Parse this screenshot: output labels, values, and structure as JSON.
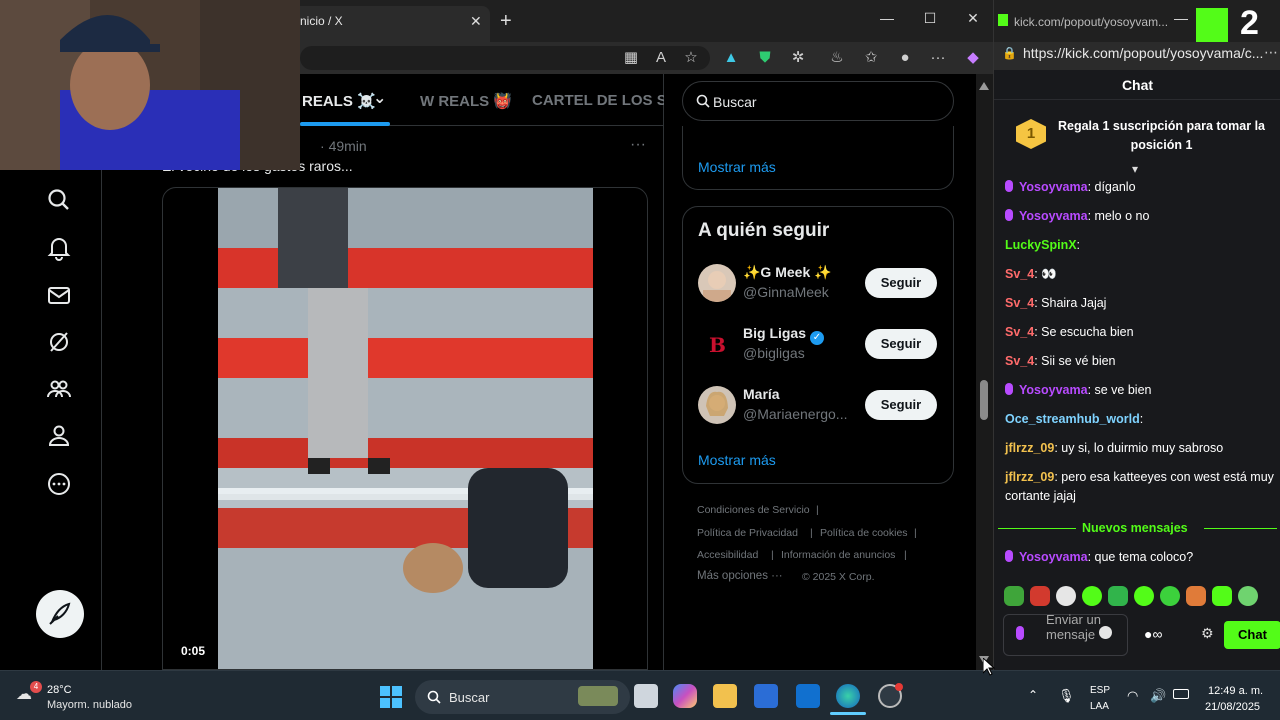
{
  "browser": {
    "tab_title": "nicio / X",
    "tab_close": "✕",
    "new_tab": "+",
    "minimize": "—",
    "maximize": "☐",
    "close": "✕"
  },
  "x": {
    "tabs": [
      {
        "label": "REALS ☠️"
      },
      {
        "label": "W REALS 👹"
      },
      {
        "label": "CARTEL DE LOS SAI"
      }
    ],
    "post": {
      "time": "49min",
      "text": "El vecino de los gastes raros...",
      "video_time": "0:05"
    },
    "sidebar": {
      "search_placeholder": "Buscar",
      "top_card_link": "Mostrar más",
      "follow_title": "A quién seguir",
      "follow": [
        {
          "name": "✨G Meek ✨",
          "handle": "@GinnaMeek",
          "button": "Seguir"
        },
        {
          "name": "Big Ligas",
          "handle": "@bigligas",
          "button": "Seguir"
        },
        {
          "name": "María",
          "handle": "@Mariaenergo...",
          "button": "Seguir"
        }
      ],
      "follow_more": "Mostrar más",
      "footer": {
        "terms": "Condiciones de Servicio",
        "privacy": "Política de Privacidad",
        "cookies": "Política de cookies",
        "accessibility": "Accesibilidad",
        "ads": "Información de anuncios",
        "more": "Más opciones ···",
        "copyright": "© 2025 X Corp."
      }
    }
  },
  "kick": {
    "tab_title": "kick.com/popout/yosoyvam...",
    "url": "https://kick.com/popout/yosoyvama/c...",
    "badge_number": "2",
    "chat_title": "Chat",
    "gift_position": "1",
    "gift_text": "Regala 1 suscripción para tomar la posición 1",
    "messages": [
      {
        "user": "Yosoyvama",
        "text": ": díganlo",
        "color": "#b84bff",
        "mic": true
      },
      {
        "user": "Yosoyvama",
        "text": ": melo o no",
        "color": "#b84bff",
        "mic": true
      },
      {
        "user": "LuckySpinX",
        "text": ":",
        "color": "#53fc18",
        "mic": false
      },
      {
        "user": "Sv_4",
        "text": ": 👀",
        "color": "#ff6b6b",
        "mic": false
      },
      {
        "user": "Sv_4",
        "text": ": Shaira Jajaj",
        "color": "#ff6b6b",
        "mic": false
      },
      {
        "user": "Sv_4",
        "text": ": Se escucha bien",
        "color": "#ff6b6b",
        "mic": false
      },
      {
        "user": "Sv_4",
        "text": ": Sii se vé bien",
        "color": "#ff6b6b",
        "mic": false
      },
      {
        "user": "Yosoyvama",
        "text": ": se ve bien",
        "color": "#b84bff",
        "mic": true
      },
      {
        "user": "Oce_streamhub_world",
        "text": ":",
        "color": "#7fd3ff",
        "mic": false
      },
      {
        "user": "jflrzz_09",
        "text": ": uy si, lo duirmio muy sabroso",
        "color": "#f2c14e",
        "mic": false
      },
      {
        "user": "jflrzz_09",
        "text": ": pero esa katteeyes con west está muy cortante jajaj",
        "color": "#f2c14e",
        "mic": false
      }
    ],
    "new_messages": "Nuevos mensajes",
    "latest": {
      "user": "Yosoyvama",
      "text": ": que tema coloco?",
      "color": "#b84bff"
    },
    "input_placeholder": "Enviar un mensaje",
    "send_label": "Chat"
  },
  "taskbar": {
    "weather_temp": "28°C",
    "weather_desc": "Mayorm. nublado",
    "weather_badge": "4",
    "search": "Buscar",
    "lang1": "ESP",
    "lang2": "LAA",
    "time": "12:49 a. m.",
    "date": "21/08/2025"
  }
}
